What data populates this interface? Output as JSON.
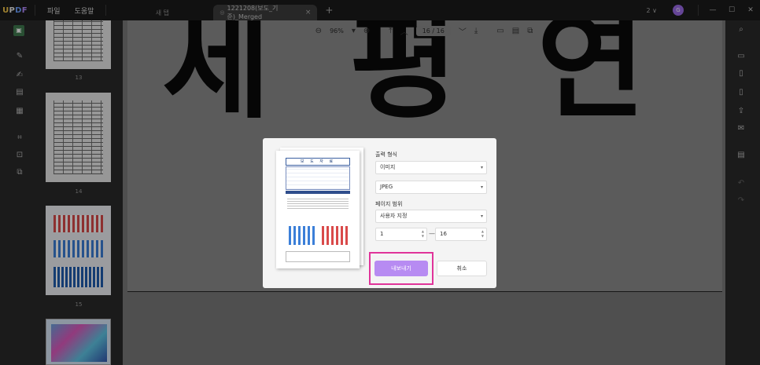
{
  "app": {
    "logo": {
      "u": "U",
      "p": "P",
      "d": "D",
      "f": "F"
    },
    "menu": [
      "파일",
      "도움말"
    ],
    "tabs": [
      {
        "label": "새 탭"
      },
      {
        "label": "1221208(보도_기준)_Merged",
        "close": "×"
      }
    ],
    "new_tab": "+",
    "page_counter": "2 ∨",
    "avatar": "G",
    "window_buttons": [
      "—",
      "☐",
      "✕"
    ]
  },
  "toolbar": {
    "zoom_out": "⊖",
    "zoom": "96%",
    "zoom_caret": "▾",
    "zoom_in": "⊕",
    "first_page": "⤒",
    "prev_page": "︿",
    "current_page": "16",
    "page_sep": "/",
    "total_pages": "16",
    "next_page": "﹀",
    "last_page": "⤓",
    "comment": "▭",
    "view": "▤",
    "more": "⧉"
  },
  "thumbnails": [
    {
      "label": "13"
    },
    {
      "label": "14"
    },
    {
      "label": "15"
    }
  ],
  "document": {
    "big_text": "세 평 연 노"
  },
  "dialog": {
    "output_format_label": "출력 형식",
    "output_format_value": "이미지",
    "image_type_value": "JPEG",
    "page_range_label": "페이지 범위",
    "page_range_value": "사용자 지정",
    "range_from": "1",
    "range_dash": "—",
    "range_to": "16",
    "export_button": "내보내기",
    "cancel_button": "취소",
    "preview_title": "보 도 자 료",
    "caret": "▾",
    "spin": "▲\n▼"
  }
}
